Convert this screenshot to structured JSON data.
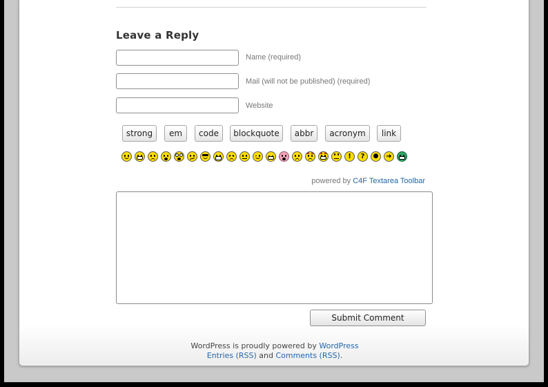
{
  "reply": {
    "heading": "Leave a Reply",
    "fields": [
      {
        "label": "Name (required)",
        "value": ""
      },
      {
        "label": "Mail (will not be published) (required)",
        "value": ""
      },
      {
        "label": "Website",
        "value": ""
      }
    ]
  },
  "toolbar": {
    "buttons": [
      "strong",
      "em",
      "code",
      "blockquote",
      "abbr",
      "acronym",
      "link"
    ],
    "smilies": [
      "smile",
      "grin",
      "sad",
      "surprised",
      "eek",
      "confused",
      "cool",
      "laugh",
      "mad",
      "neutral",
      "wink",
      "lol",
      "redface",
      "cry",
      "evil",
      "twisted",
      "rolleyes",
      "exclaim",
      "question",
      "idea",
      "arrow",
      "mrgreen"
    ],
    "powered_prefix": "powered by",
    "powered_link": "C4F Textarea Toolbar"
  },
  "comment": {
    "value": "",
    "submit_label": "Submit Comment"
  },
  "footer": {
    "line1_text": "WordPress is proudly powered by",
    "line1_link": "WordPress",
    "entries_link": "Entries (RSS)",
    "and_text": "and",
    "comments_link": "Comments (RSS)",
    "period": "."
  },
  "colors": {
    "link": "#2266aa",
    "window_background": "#c9c9c9",
    "smiley_yellow": "#ffdd00"
  }
}
